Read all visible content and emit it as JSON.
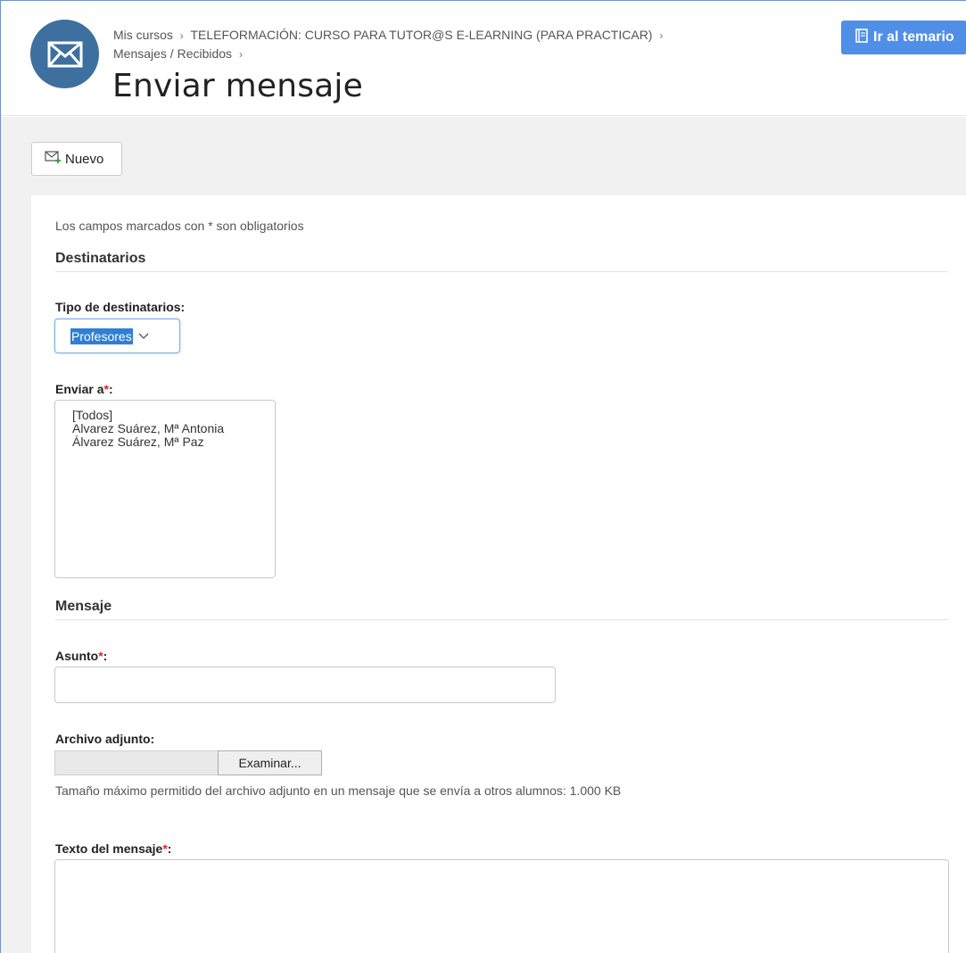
{
  "header": {
    "breadcrumb": {
      "item1": "Mis cursos",
      "item2": "TELEFORMACIÓN: CURSO PARA TUTOR@S E-LEARNING (PARA PRACTICAR)",
      "item3": "Mensajes / Recibidos",
      "separator": "›"
    },
    "title": "Enviar mensaje",
    "temario_button": "Ir al temario",
    "accent_color": "#4f8fe8",
    "icon_circle_color": "#3d6f9f"
  },
  "toolbar": {
    "nuevo_button": "Nuevo"
  },
  "form": {
    "required_note": "Los campos marcados con * son obligatorios",
    "destinatarios_section": "Destinatarios",
    "tipo_label": "Tipo de destinatarios:",
    "tipo_selected": "Profesores",
    "enviar_a_label": "Enviar a",
    "required_mark": "*",
    "colon": ":",
    "recipients": [
      "[Todos]",
      "Alvarez Suárez, Mª Antonia",
      "Álvarez Suárez, Mª Paz"
    ],
    "mensaje_section": "Mensaje",
    "asunto_label": "Asunto",
    "asunto_value": "",
    "archivo_label": "Archivo adjunto:",
    "examinar_button": "Examinar...",
    "size_help": "Tamaño máximo permitido del archivo adjunto en un mensaje que se envía a otros alumnos: 1.000 KB",
    "texto_label": "Texto del mensaje",
    "texto_value": ""
  }
}
